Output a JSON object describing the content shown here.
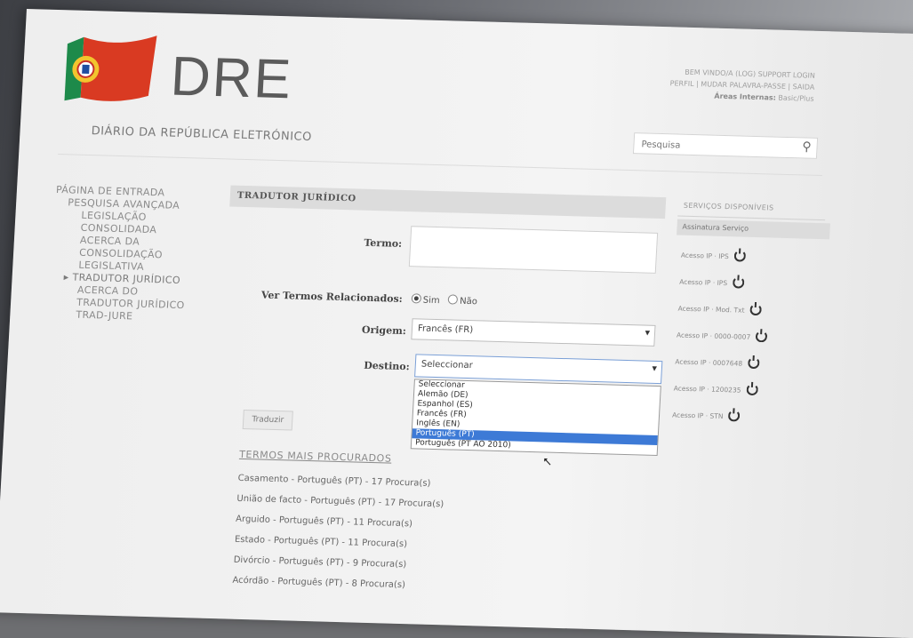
{
  "brand": {
    "name": "DRE",
    "tagline": "DIÁRIO DA REPÚBLICA ELETRÓNICO"
  },
  "header": {
    "links_line1": "BEM VINDO/A (LOG) SUPPORT LOGIN",
    "links_line2": "PERFIL | MUDAR PALAVRA-PASSE | SAIDA",
    "links_line3_label": "Áreas Internas:",
    "links_line3_value": "Basic/Plus",
    "search_placeholder": "Pesquisa"
  },
  "nav": {
    "items": [
      {
        "label": "PÁGINA DE ENTRADA",
        "level": 0
      },
      {
        "label": "PESQUISA AVANÇADA",
        "level": 1
      },
      {
        "label": "LEGISLAÇÃO",
        "level": 2
      },
      {
        "label": "CONSOLIDADA",
        "level": 2
      },
      {
        "label": "ACERCA DA",
        "level": 2
      },
      {
        "label": "CONSOLIDAÇÃO",
        "level": 2
      },
      {
        "label": "LEGISLATIVA",
        "level": 2
      },
      {
        "label": "▸ TRADUTOR JURÍDICO",
        "level": 1
      },
      {
        "label": "ACERCA DO",
        "level": 2
      },
      {
        "label": "TRADUTOR JURÍDICO",
        "level": 2
      },
      {
        "label": "TRAD-JURE",
        "level": 2
      }
    ]
  },
  "panel": {
    "title": "TRADUTOR JURÍDICO",
    "termo_label": "Termo:",
    "related_label": "Ver Termos Relacionados:",
    "radio_yes": "Sim",
    "radio_no": "Não",
    "origem_label": "Origem:",
    "origem_value": "Francês (FR)",
    "destino_label": "Destino:",
    "destino_value": "Seleccionar",
    "destino_options": [
      "Seleccionar",
      "Alemão (DE)",
      "Espanhol (ES)",
      "Francês (FR)",
      "Inglês (EN)",
      "Português (PT)",
      "Português (PT AO 2010)"
    ],
    "highlighted_option": "Português (PT)",
    "translate_button": "Traduzir"
  },
  "most_searched": {
    "title": "TERMOS MAIS PROCURADOS",
    "items": [
      "Casamento - Português (PT) - 17 Procura(s)",
      "União de facto - Português (PT) - 17 Procura(s)",
      "Arguido - Português (PT) - 11 Procura(s)",
      "Estado - Português (PT) - 11 Procura(s)",
      "Divórcio - Português (PT) - 9 Procura(s)",
      "Acórdão - Português (PT) - 8 Procura(s)"
    ]
  },
  "services": {
    "title": "SERVIÇOS DISPONÍVEIS",
    "head": "Assinatura Serviço",
    "items": [
      "Acesso IP · IPS",
      "Acesso IP · IPS",
      "Acesso IP · Mod. Txt",
      "Acesso IP · 0000-0007",
      "Acesso IP · 0007648",
      "Acesso IP · 1200235",
      "Acesso IP · STN"
    ]
  },
  "colors": {
    "highlight": "#3d7ad6",
    "ribbon_green": "#1d8a4a",
    "ribbon_red": "#c8302a"
  }
}
